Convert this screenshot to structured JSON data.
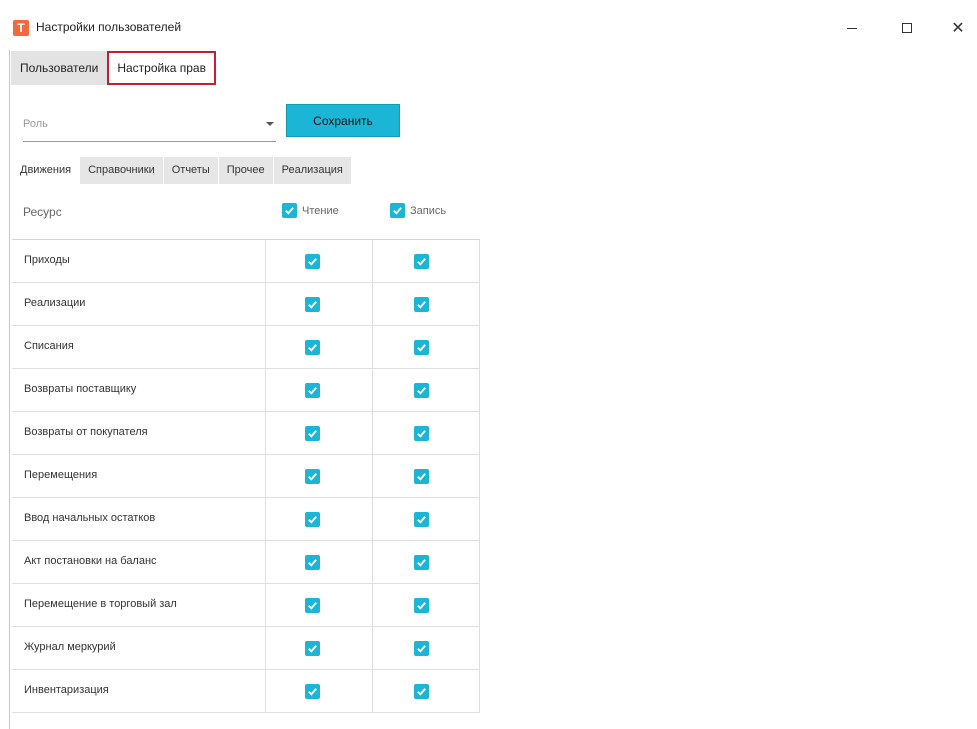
{
  "window": {
    "title": "Настройки пользователей",
    "app_icon_letter": "T",
    "accent_color": "#1bb6d5",
    "highlight_color": "#c8202a"
  },
  "top_tabs": [
    {
      "label": "Пользователи"
    },
    {
      "label": "Настройка прав"
    }
  ],
  "role": {
    "placeholder": "Роль",
    "value": ""
  },
  "save_button": {
    "label": "Сохранить"
  },
  "sub_tabs": [
    {
      "label": "Движения"
    },
    {
      "label": "Справочники"
    },
    {
      "label": "Отчеты"
    },
    {
      "label": "Прочее"
    },
    {
      "label": "Реализация"
    }
  ],
  "table": {
    "header_resource": "Ресурс",
    "header_read": "Чтение",
    "header_write": "Запись",
    "rows": [
      {
        "name": "Приходы",
        "read": true,
        "write": true
      },
      {
        "name": "Реализации",
        "read": true,
        "write": true
      },
      {
        "name": "Списания",
        "read": true,
        "write": true
      },
      {
        "name": "Возвраты поставщику",
        "read": true,
        "write": true
      },
      {
        "name": "Возвраты от покупателя",
        "read": true,
        "write": true
      },
      {
        "name": "Перемещения",
        "read": true,
        "write": true
      },
      {
        "name": "Ввод начальных остатков",
        "read": true,
        "write": true
      },
      {
        "name": "Акт постановки на баланс",
        "read": true,
        "write": true
      },
      {
        "name": "Перемещение в торговый зал",
        "read": true,
        "write": true
      },
      {
        "name": "Журнал меркурий",
        "read": true,
        "write": true
      },
      {
        "name": "Инвентаризация",
        "read": true,
        "write": true
      }
    ]
  }
}
